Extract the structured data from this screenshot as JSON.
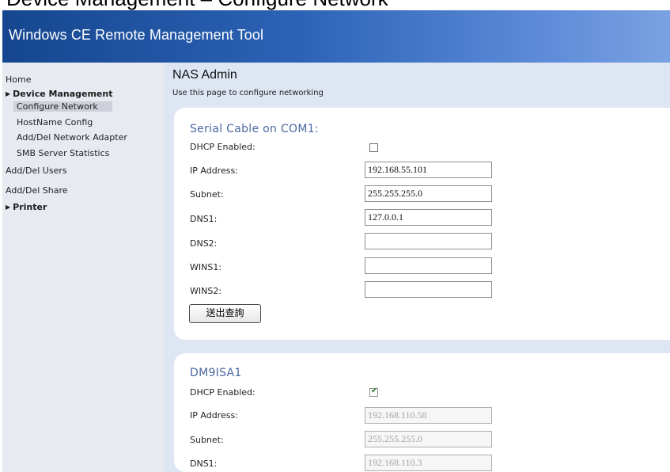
{
  "slide": {
    "title": "Device Management – Configure Network"
  },
  "app": {
    "title": "Windows CE Remote Management Tool"
  },
  "sidebar": {
    "home": "Home",
    "device_management": "Device Management",
    "sub": [
      "Configure Network",
      "HostName Config",
      "Add/Del Network Adapter",
      "SMB Server Statistics"
    ],
    "users": "Add/Del Users",
    "share": "Add/Del Share",
    "printer": "Printer"
  },
  "page": {
    "title": "NAS Admin",
    "description": "Use this page to configure networking"
  },
  "adapters": [
    {
      "name": "Serial Cable on COM1:",
      "dhcp_label": "DHCP Enabled:",
      "dhcp_enabled": false,
      "ip_label": "IP Address:",
      "ip": "192.168.55.101",
      "subnet_label": "Subnet:",
      "subnet": "255.255.255.0",
      "dns1_label": "DNS1:",
      "dns1": "127.0.0.1",
      "dns2_label": "DNS2:",
      "dns2": "",
      "wins1_label": "WINS1:",
      "wins1": "",
      "wins2_label": "WINS2:",
      "wins2": "",
      "submit_label": "送出查詢"
    },
    {
      "name": "DM9ISA1",
      "dhcp_label": "DHCP Enabled:",
      "dhcp_enabled": true,
      "ip_label": "IP Address:",
      "ip": "192.168.110.58",
      "subnet_label": "Subnet:",
      "subnet": "255.255.255.0",
      "dns1_label": "DNS1:",
      "dns1": "192.168.110.3"
    }
  ],
  "colors": {
    "banner": "#2d63b6",
    "sidebar": "#e8eaf2",
    "content": "#dde6f2",
    "panel_title": "#4a67a0"
  }
}
